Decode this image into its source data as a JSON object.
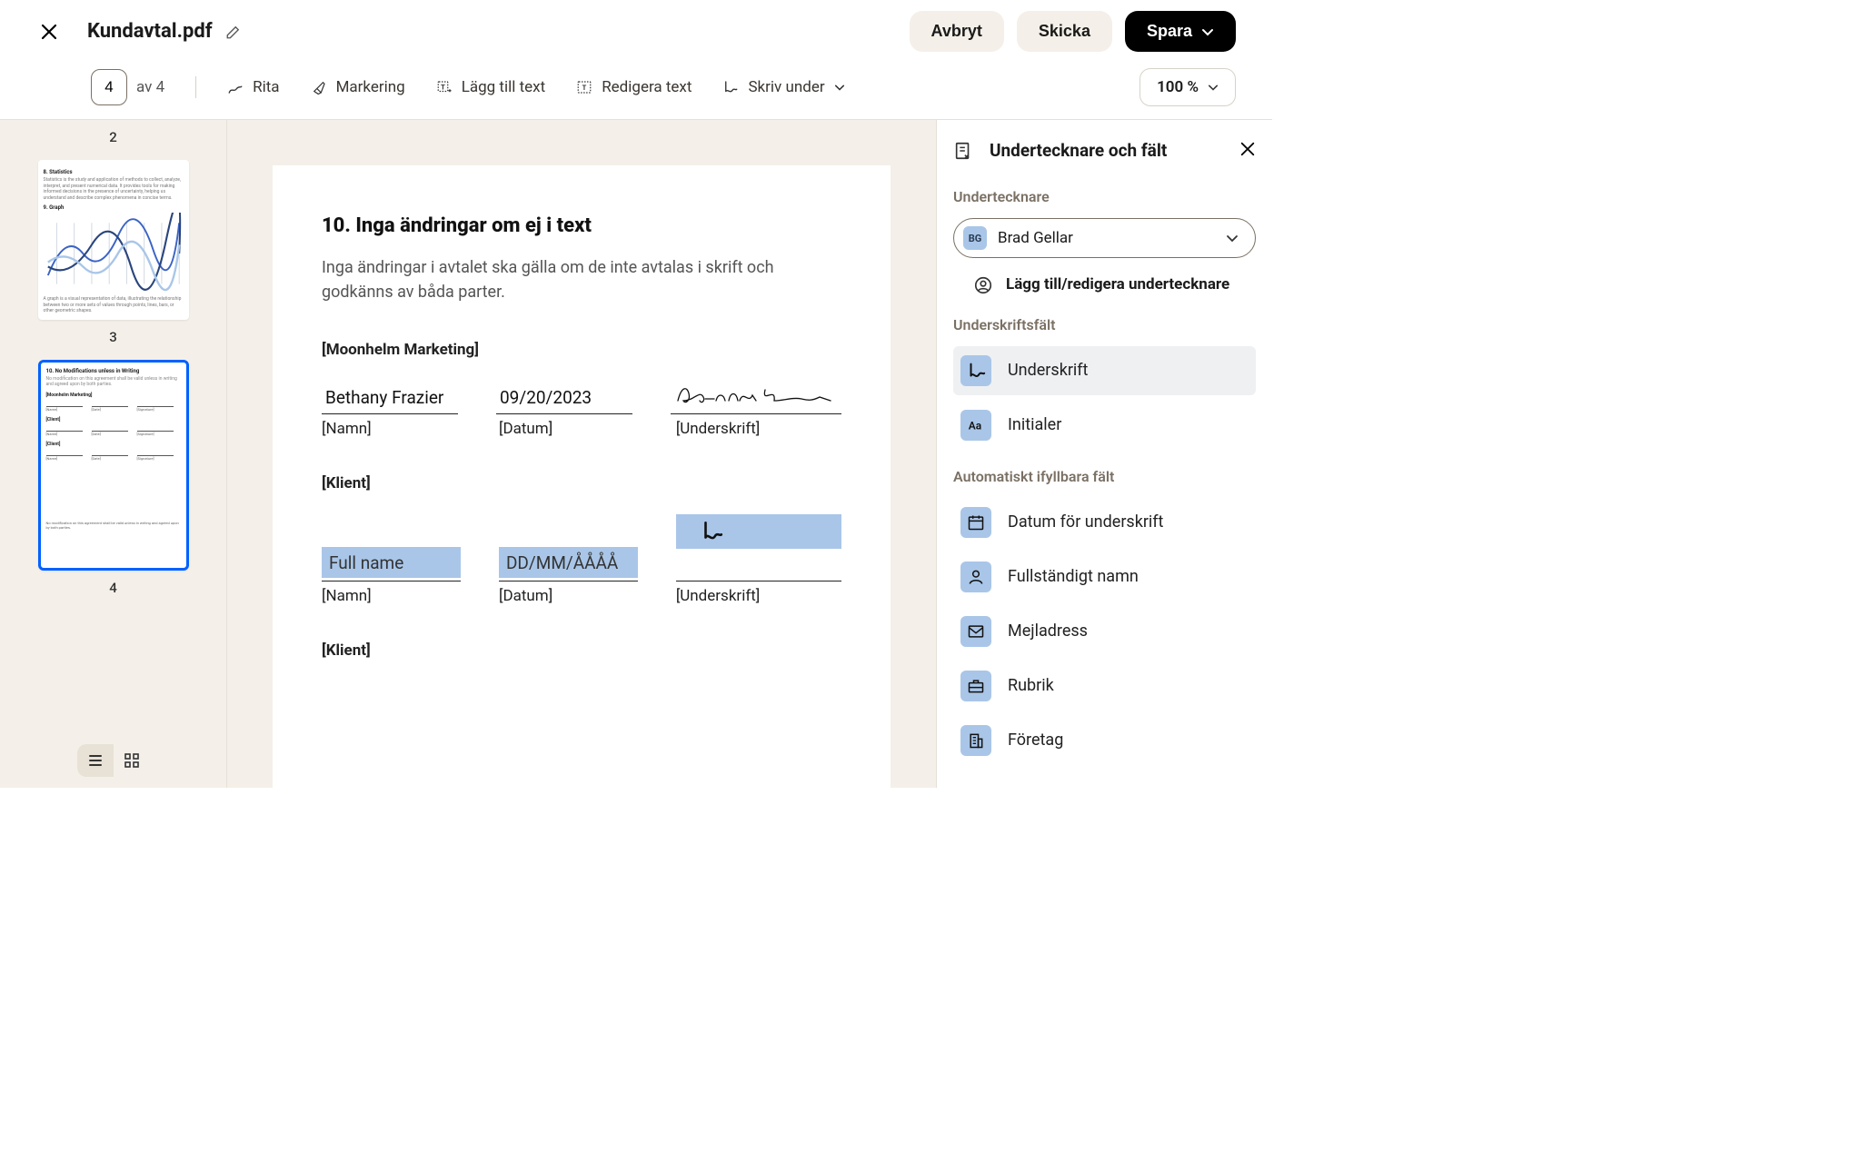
{
  "header": {
    "filename": "Kundavtal.pdf",
    "cancel": "Avbryt",
    "send": "Skicka",
    "save": "Spara"
  },
  "toolbar": {
    "page_current": "4",
    "page_total": "av 4",
    "draw": "Rita",
    "highlight": "Markering",
    "add_text": "Lägg till text",
    "edit_text": "Redigera text",
    "sign": "Skriv under",
    "zoom": "100 %"
  },
  "thumbs": {
    "t2_label": "2",
    "t3_label": "3",
    "t4_label": "4",
    "t3": {
      "sec8": "8. Statistics",
      "sec8_body": "Statistics is the study and application of methods to collect, analyze, interpret, and present numerical data. It provides tools for making informed decisions in the presence of uncertainty, helping us understand and describe complex phenomena in concise terms.",
      "sec9": "9. Graph",
      "sec9_body": "A graph is a visual representation of data, illustrating the relationship between two or more sets of values through points, lines, bars, or other geometric shapes."
    },
    "t4": {
      "heading": "10. No Modifications unless in Writing",
      "body": "No modification on this agreement shall be valid unless in writing and agreed upon by both parties.",
      "party": "[Moonhelm Marketing]",
      "client": "[Client]",
      "name": "[Name]",
      "date": "[Date]",
      "sig": "[Signature]",
      "footer": "No modification on this agreement shall be valid unless in writing and agreed upon by both parties."
    }
  },
  "doc": {
    "heading": "10. Inga ändringar om ej i text",
    "body": "Inga ändringar i avtalet ska gälla om de inte avtalas i skrift och godkänns av båda parter.",
    "party_company": "[Moonhelm Marketing]",
    "row1": {
      "name": "Bethany Frazier",
      "date": "09/20/2023"
    },
    "labels": {
      "name": "[Namn]",
      "date": "[Datum]",
      "signature": "[Underskrift]"
    },
    "party_client": "[Klient]",
    "placeholders": {
      "fullname": "Full name",
      "date": "DD/MM/ÅÅÅÅ"
    },
    "party_client2": "[Klient]"
  },
  "sidebar": {
    "title": "Undertecknare och fält",
    "section_signers": "Undertecknare",
    "signer_initials": "BG",
    "signer_name": "Brad Gellar",
    "add_edit_signer": "Lägg till/redigera undertecknare",
    "section_sigfields": "Underskriftsfält",
    "f_signature": "Underskrift",
    "f_initials": "Initialer",
    "section_autofill": "Automatiskt ifyllbara fält",
    "f_date": "Datum för underskrift",
    "f_fullname": "Fullständigt namn",
    "f_email": "Mejladress",
    "f_title": "Rubrik",
    "f_company": "Företag"
  }
}
